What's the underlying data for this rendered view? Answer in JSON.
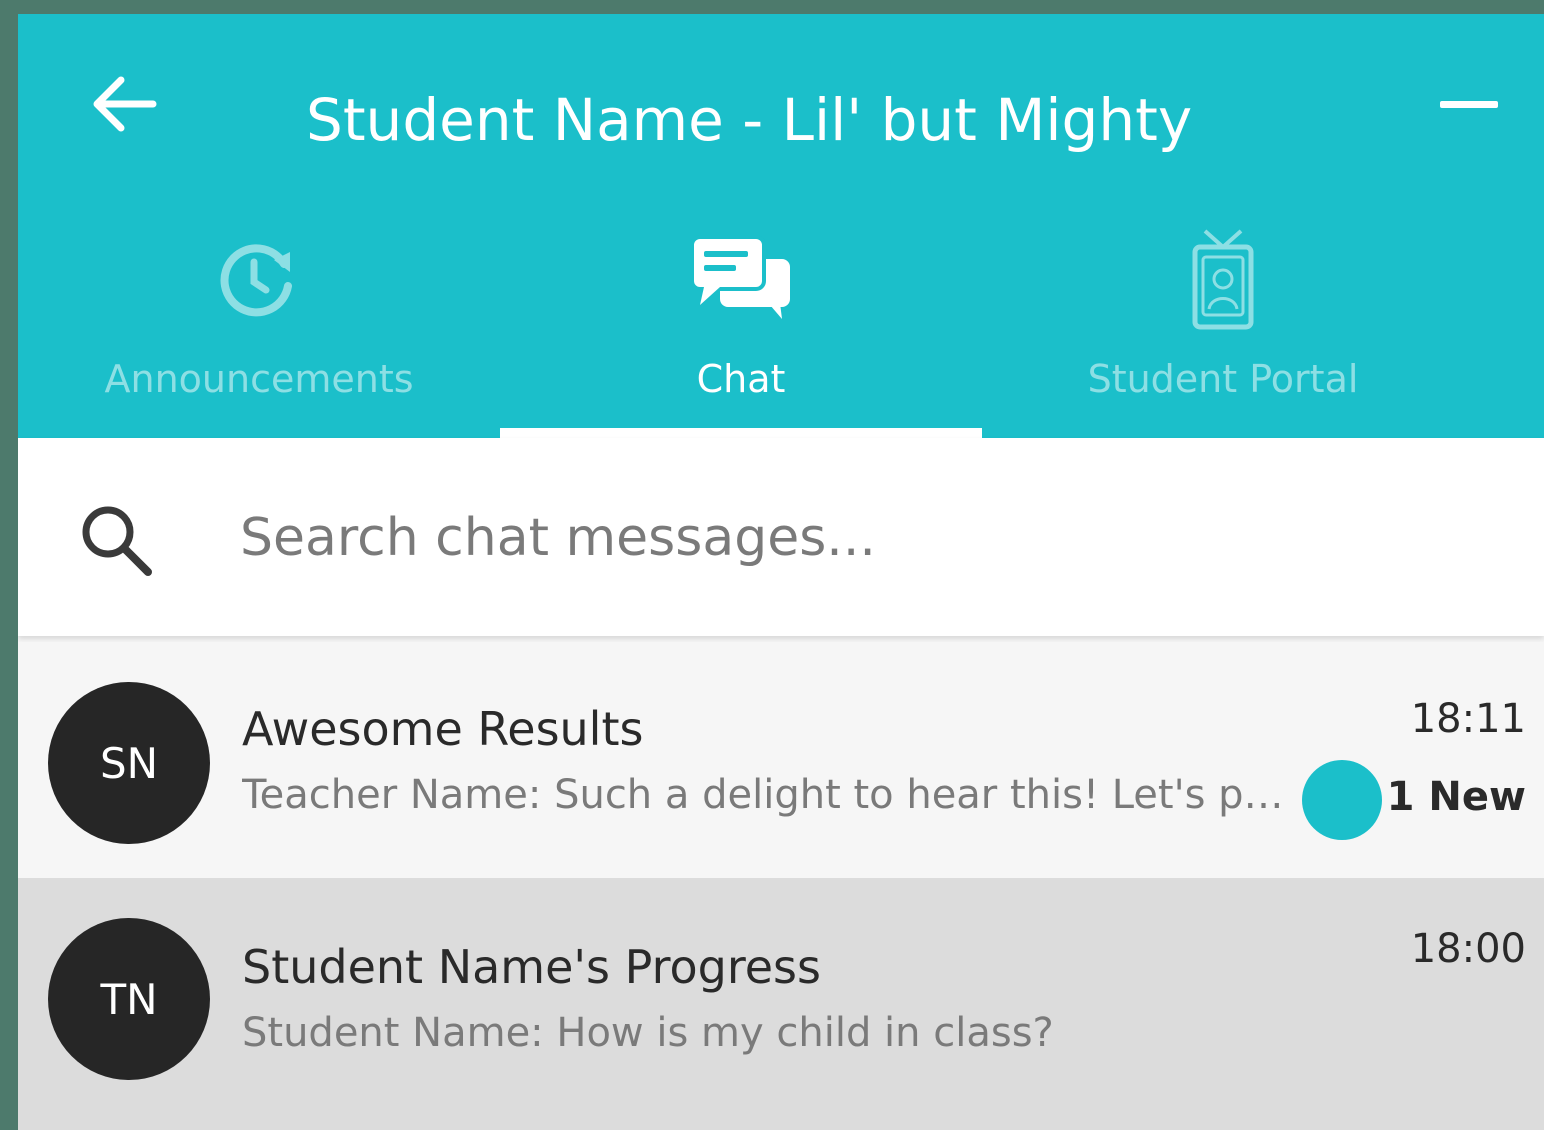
{
  "app": {
    "title": "Student Name - Lil' but Mighty",
    "accent_color": "#1bbfca"
  },
  "header": {
    "back_icon": "arrow-left-icon",
    "menu_icon": "minimize-icon"
  },
  "tabs": [
    {
      "label": "Announcements",
      "icon": "clock-refresh-icon",
      "active": false
    },
    {
      "label": "Chat",
      "icon": "chat-bubbles-icon",
      "active": true
    },
    {
      "label": "Student Portal",
      "icon": "id-badge-icon",
      "active": false
    }
  ],
  "search": {
    "placeholder": "Search chat messages...",
    "value": ""
  },
  "chats": [
    {
      "initials": "SN",
      "title": "Awesome Results",
      "preview": "Teacher Name: Such a delight to hear this! Let's pre...",
      "time": "18:11",
      "badge": "1 New"
    },
    {
      "initials": "TN",
      "title": "Student Name's Progress",
      "preview": "Student Name: How is my child in class?",
      "time": "18:00"
    }
  ]
}
